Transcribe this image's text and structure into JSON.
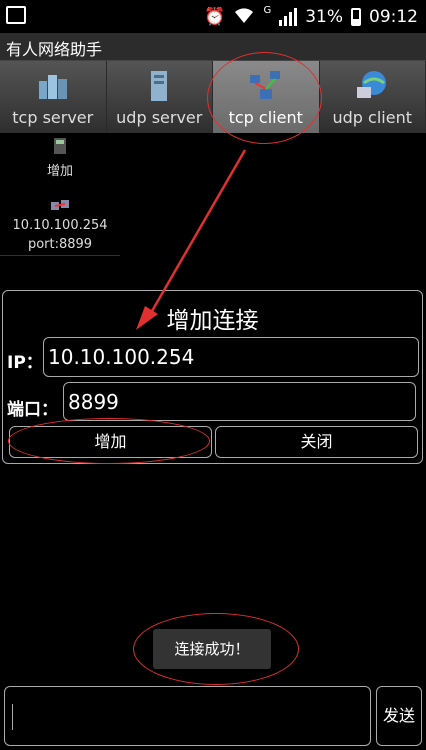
{
  "status_bar": {
    "network": "G",
    "battery": "31%",
    "time": "09:12"
  },
  "app": {
    "title": "有人网络助手"
  },
  "tabs": [
    {
      "label": "tcp server",
      "icon": "server-cluster-icon"
    },
    {
      "label": "udp server",
      "icon": "server-rack-icon"
    },
    {
      "label": "tcp client",
      "icon": "network-client-icon",
      "active": true
    },
    {
      "label": "udp client",
      "icon": "globe-computer-icon"
    }
  ],
  "list": {
    "add_label": "增加",
    "connection": {
      "ip": "10.10.100.254",
      "port": "port:8899"
    }
  },
  "dialog": {
    "title": "增加连接",
    "ip_label": "IP：",
    "ip_value": "10.10.100.254",
    "port_label": "端口：",
    "port_value": "8899",
    "add_button": "增加",
    "close_button": "关闭"
  },
  "toast": {
    "text": "连接成功！"
  },
  "bottom": {
    "send_button": "发送",
    "message_value": ""
  },
  "colors": {
    "annotation": "#e03030",
    "active_tab": "#7a7a7a"
  }
}
